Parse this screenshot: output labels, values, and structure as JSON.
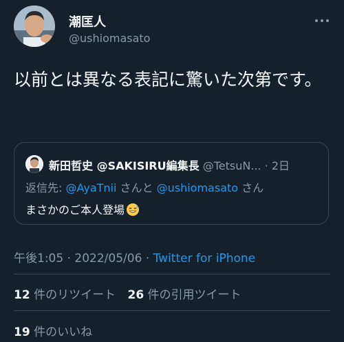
{
  "author": {
    "name": "潮匡人",
    "handle": "@ushiomasato"
  },
  "tweet": {
    "text": "以前とは異なる表記に驚いた次第です。"
  },
  "quote": {
    "name": "新田哲史 @SAKISIRU編集長",
    "handle_trunc": "@TetsuN...",
    "separator": " · ",
    "time": "2日",
    "reply_prefix": "返信先: ",
    "reply_user1": "@AyaTnii",
    "reply_mid": " さんと ",
    "reply_user2": "@ushiomasato",
    "reply_suffix": " さん",
    "body": "まさかのご本人登場",
    "emoji": "grinning-sweat-emoji"
  },
  "meta": {
    "time": "午後1:05",
    "sep1": " · ",
    "date": "2022/05/06",
    "sep2": " · ",
    "source": "Twitter for iPhone"
  },
  "stats": {
    "retweets_count": "12",
    "retweets_label": " 件のリツイート",
    "quotes_count": "26",
    "quotes_label": " 件の引用ツイート",
    "likes_count": "19",
    "likes_label": " 件のいいね"
  },
  "icons": {
    "more": "more-dots-icon"
  },
  "colors": {
    "background": "#15202b",
    "link": "#1d9bf0",
    "secondary_text": "#8b98a5",
    "border": "#38444d"
  }
}
